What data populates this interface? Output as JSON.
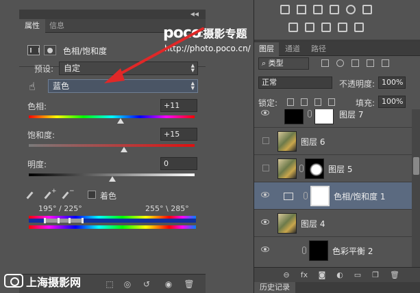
{
  "properties_panel": {
    "tabs": [
      "属性",
      "信息"
    ],
    "title": "色相/饱和度",
    "preset_label": "预设:",
    "preset_value": "自定",
    "channel_value": "蓝色",
    "hue_label": "色相:",
    "hue_value": "+11",
    "saturation_label": "饱和度:",
    "saturation_value": "+15",
    "lightness_label": "明度:",
    "lightness_value": "0",
    "colorize_label": "着色",
    "range_left": "195° / 225°",
    "range_right": "255° \\ 285°"
  },
  "watermark": {
    "brand": "poco",
    "brand_cn": "摄影专题",
    "url": "http://photo.poco.cn/"
  },
  "layers_panel": {
    "tabs": [
      "图层",
      "通道",
      "路径"
    ],
    "filter_value": "类型",
    "blend_mode": "正常",
    "opacity_label": "不透明度:",
    "opacity_value": "100%",
    "lock_label": "锁定:",
    "fill_label": "填充:",
    "fill_value": "100%",
    "layers": [
      {
        "name": "图层 7",
        "visible": true,
        "selected": false
      },
      {
        "name": "图层 6",
        "visible": false,
        "selected": false
      },
      {
        "name": "图层 5",
        "visible": false,
        "selected": false
      },
      {
        "name": "色相/饱和度 1",
        "visible": true,
        "selected": true
      },
      {
        "name": "图层 4",
        "visible": true,
        "selected": false
      },
      {
        "name": "色彩平衡 2",
        "visible": true,
        "selected": false
      }
    ],
    "history_tab": "历史记录"
  },
  "footer_logo": "上海摄影网"
}
